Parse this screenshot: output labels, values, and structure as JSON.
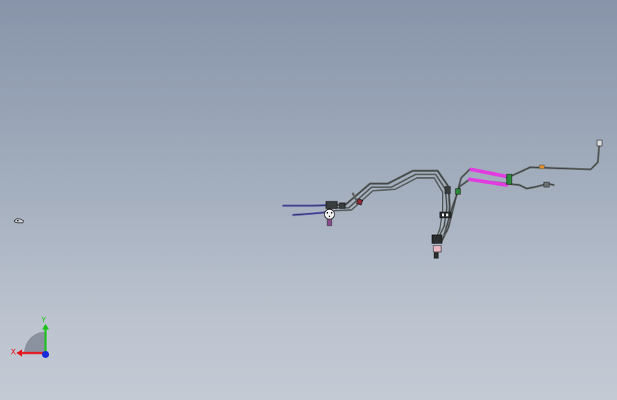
{
  "triad": {
    "x_label": "X",
    "y_label": "Y",
    "x_color": "#e8141c",
    "y_color": "#1ec21e",
    "z_color": "#1a2bd8"
  },
  "model": {
    "tube_color": "#5d6363",
    "highlight_color": "#e23ce0",
    "accent_blue": "#5a5ab4",
    "accent_green": "#2a8a3a",
    "accent_orange": "#e0902a"
  }
}
